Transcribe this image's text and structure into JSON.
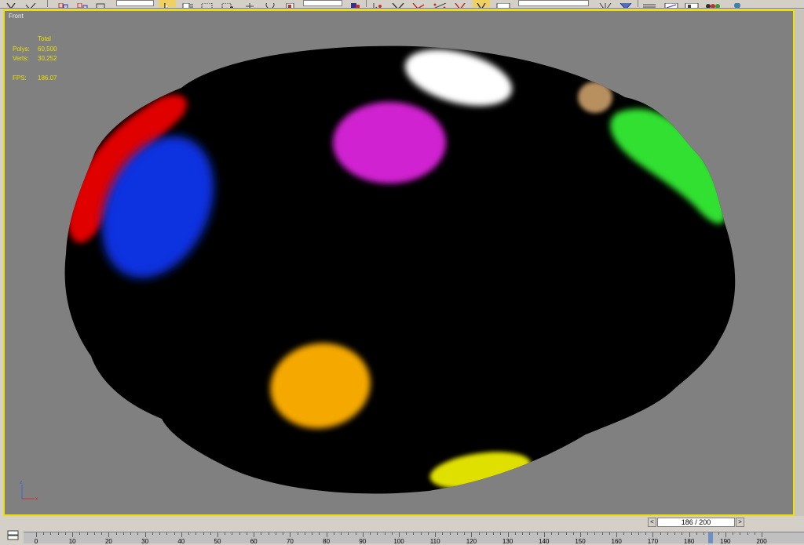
{
  "viewport": {
    "label": "Front",
    "stats": {
      "header": "Total",
      "polys_label": "Polys:",
      "polys_value": "60,500",
      "verts_label": "Verts:",
      "verts_value": "30,252",
      "fps_label": "FPS:",
      "fps_value": "186.07"
    },
    "gizmo": {
      "z": "z",
      "x": "x"
    }
  },
  "time_slider": {
    "prev": "<",
    "text": "186 / 200",
    "next": ">",
    "current_frame": 186,
    "total_frames": 200
  },
  "ruler": {
    "labels": [
      "0",
      "10",
      "20",
      "30",
      "40",
      "50",
      "60",
      "70",
      "80",
      "90",
      "100",
      "110",
      "120",
      "130",
      "140",
      "150",
      "160",
      "170",
      "180",
      "190",
      "200"
    ]
  },
  "colors": {
    "viewport_bg": "#808080",
    "active_border": "#f0e000",
    "stats_text": "#e8e000",
    "mesh": "#000000",
    "spot_red": "#e00000",
    "spot_blue": "#1030e0",
    "spot_magenta": "#d020d0",
    "spot_white": "#ffffff",
    "spot_tan": "#b89060",
    "spot_green": "#30e030",
    "spot_orange": "#f5a800",
    "spot_yellow": "#e0e000"
  }
}
